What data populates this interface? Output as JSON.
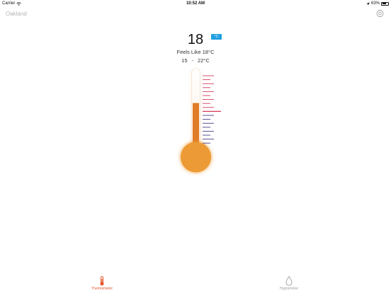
{
  "status": {
    "carrier": "Carrier",
    "time": "10:52 AM",
    "battery": "63%",
    "battery_level": 0.63
  },
  "header": {
    "city": "Oakland"
  },
  "reading": {
    "temperature": "18",
    "unit": "°C",
    "feels_like": "Feels Like 18°C",
    "range_low": "15",
    "range_sep": "-",
    "range_high": "22°C",
    "fill_fraction": 0.62
  },
  "tabs": [
    {
      "label": "Thermometer",
      "active": true
    },
    {
      "label": "Hygrometer",
      "active": false
    }
  ],
  "colors": {
    "accent": "#e4572e",
    "bulb": "#ec9a35",
    "badge": "#1f9ee0",
    "tick_warm": "#d63a5a",
    "tick_cool": "#4b3d8f",
    "inactive": "#9e9e9e"
  }
}
